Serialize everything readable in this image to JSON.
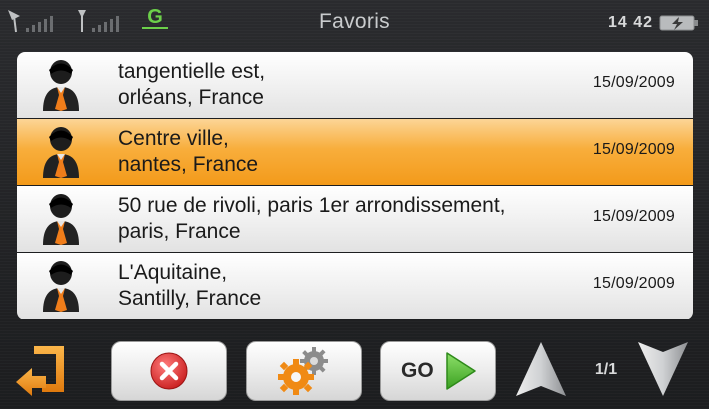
{
  "header": {
    "title": "Favoris",
    "time": "14 42",
    "gprs_label": "G",
    "icons": [
      "gps-signal-icon",
      "gsm-signal-icon",
      "gprs-icon",
      "battery-charging-icon"
    ]
  },
  "favorites": [
    {
      "line1": "tangentielle est,",
      "line2": "orléans, France",
      "date": "15/09/2009",
      "selected": false
    },
    {
      "line1": "Centre ville,",
      "line2": "nantes, France",
      "date": "15/09/2009",
      "selected": true
    },
    {
      "line1": "50 rue de rivoli, paris 1er arrondissement,",
      "line2": "paris, France",
      "date": "15/09/2009",
      "selected": false
    },
    {
      "line1": "L'Aquitaine,",
      "line2": "Santilly, France",
      "date": "15/09/2009",
      "selected": false
    }
  ],
  "toolbar": {
    "go_label": "GO",
    "page_indicator": "1/1",
    "icons": [
      "back-arrow-icon",
      "delete-icon",
      "settings-gears-icon",
      "go-arrow-icon",
      "page-up-icon",
      "page-down-icon"
    ]
  },
  "colors": {
    "selection": "#f8ae3c",
    "accent_orange": "#f39a1a",
    "go_green": "#5cc03c",
    "delete_red": "#e03a3a"
  }
}
